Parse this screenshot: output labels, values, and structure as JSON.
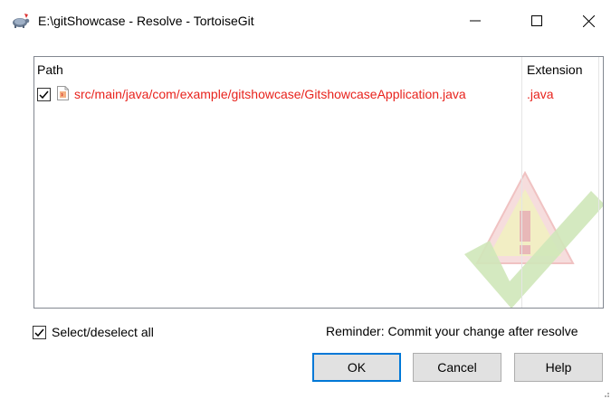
{
  "window": {
    "title": "E:\\gitShowcase - Resolve - TortoiseGit",
    "app_icon": "tortoisegit-icon"
  },
  "caption_buttons": {
    "minimize_icon": "minimize-icon",
    "maximize_icon": "maximize-icon",
    "close_icon": "close-icon"
  },
  "list": {
    "columns": {
      "path": "Path",
      "extension": "Extension"
    },
    "rows": [
      {
        "checked": true,
        "icon": "java-file-icon",
        "path": "src/main/java/com/example/gitshowcase/GitshowcaseApplication.java",
        "extension": ".java"
      }
    ],
    "watermark_icon": "conflict-warning-checkmark-icon",
    "conflict_text_color": "#e8231d"
  },
  "select_all": {
    "label": "Select/deselect all",
    "checked": true
  },
  "reminder": "Reminder: Commit your change after resolve",
  "buttons": {
    "ok": "OK",
    "cancel": "Cancel",
    "help": "Help"
  },
  "colors": {
    "accent": "#0078d7"
  }
}
